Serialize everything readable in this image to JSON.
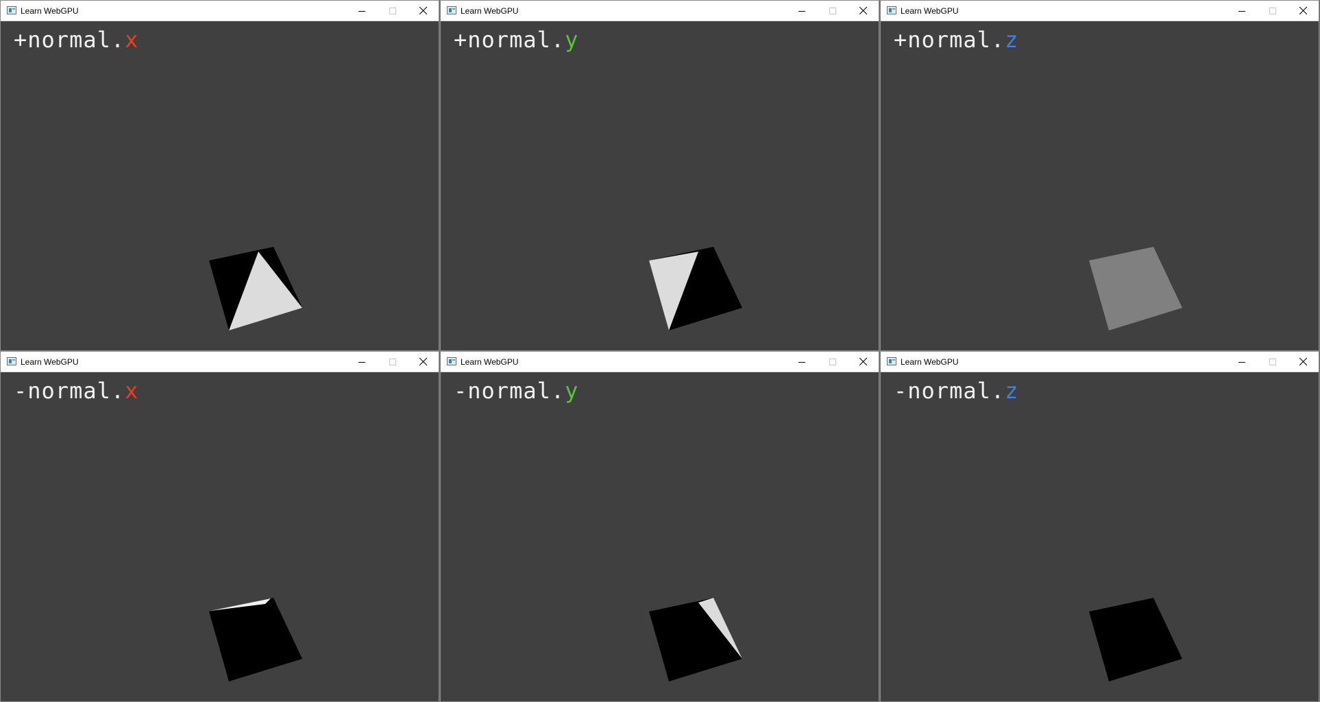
{
  "windows": [
    {
      "title": "Learn WebGPU",
      "label_prefix": "+normal.",
      "label_axis": "x",
      "axis_color": "#e8401c",
      "quad_color": "#000000",
      "face_color": "#dcdcdc"
    },
    {
      "title": "Learn WebGPU",
      "label_prefix": "+normal.",
      "label_axis": "y",
      "axis_color": "#57c43a",
      "quad_color": "#000000",
      "face_color": "#dcdcdc"
    },
    {
      "title": "Learn WebGPU",
      "label_prefix": "+normal.",
      "label_axis": "z",
      "axis_color": "#3f7fe0",
      "quad_color": "#808080"
    },
    {
      "title": "Learn WebGPU",
      "label_prefix": "-normal.",
      "label_axis": "x",
      "axis_color": "#e8401c",
      "quad_color": "#000000",
      "face_color": "#f0f0f0"
    },
    {
      "title": "Learn WebGPU",
      "label_prefix": "-normal.",
      "label_axis": "y",
      "axis_color": "#57c43a",
      "quad_color": "#000000",
      "face_color": "#dcdcdc"
    },
    {
      "title": "Learn WebGPU",
      "label_prefix": "-normal.",
      "label_axis": "z",
      "axis_color": "#3f7fe0",
      "quad_color": "#000000"
    }
  ],
  "colors": {
    "viewport_bg": "#404040",
    "titlebar_bg": "#ffffff",
    "label_text": "#f2f2f2"
  }
}
